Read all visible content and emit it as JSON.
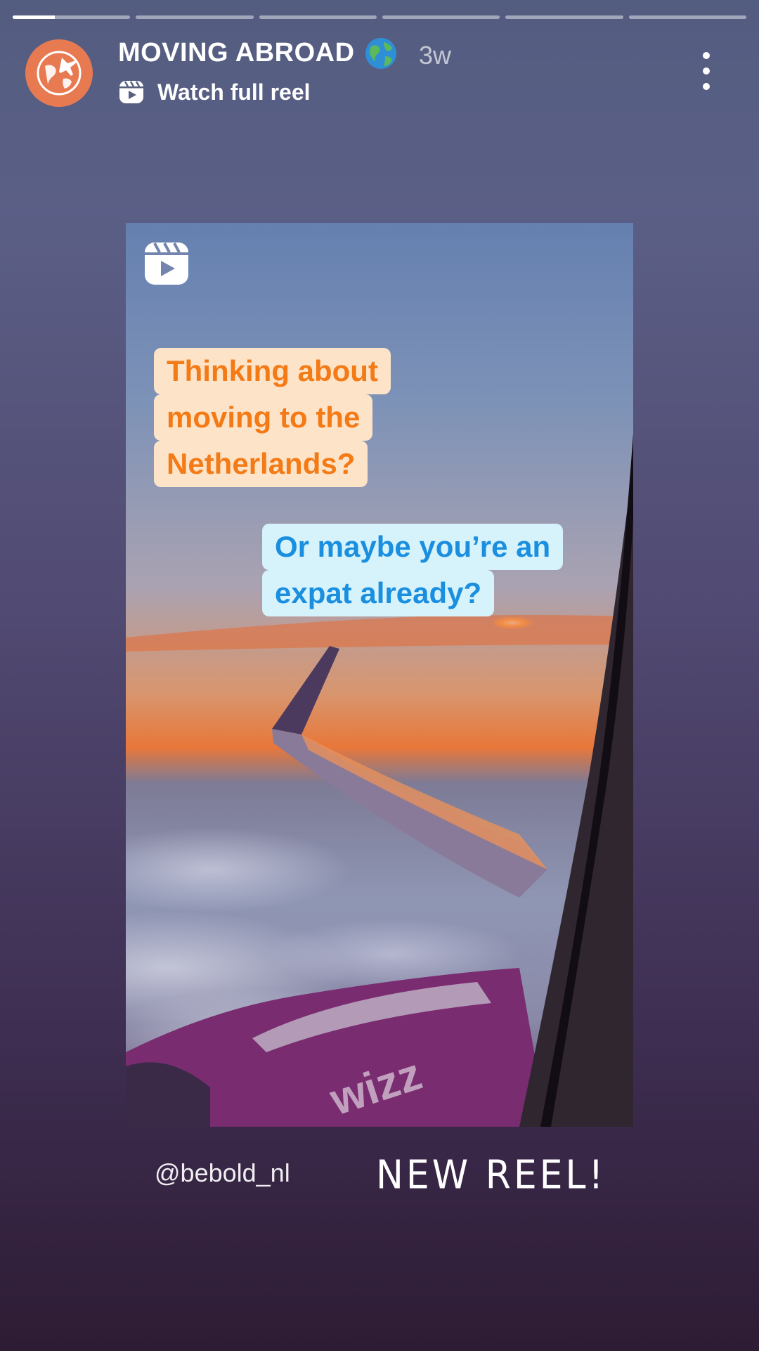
{
  "story": {
    "segments_total": 6,
    "current_segment": 1,
    "current_progress": 0.36,
    "account": {
      "username": "MOVING ABROAD",
      "emoji": "🌍",
      "posted_ago": "3w",
      "avatar_icon": "plane-globe-icon",
      "avatar_color": "#e87a52"
    },
    "link_label": "Watch full reel",
    "more_icon": "more-vertical-icon"
  },
  "reel": {
    "icon": "reels-icon",
    "caption_1": [
      "Thinking about",
      "moving to the",
      "Netherlands?"
    ],
    "caption_2": [
      "Or maybe you’re an",
      "expat already?"
    ],
    "caption_1_color": "#f47a16",
    "caption_1_bg": "#fde4c9",
    "caption_2_color": "#1a8fe0",
    "caption_2_bg": "#d6f2fb",
    "plane_text": "wizz"
  },
  "stickers": {
    "mention": "@bebold_nl",
    "new_reel": "NEW REEL!"
  }
}
